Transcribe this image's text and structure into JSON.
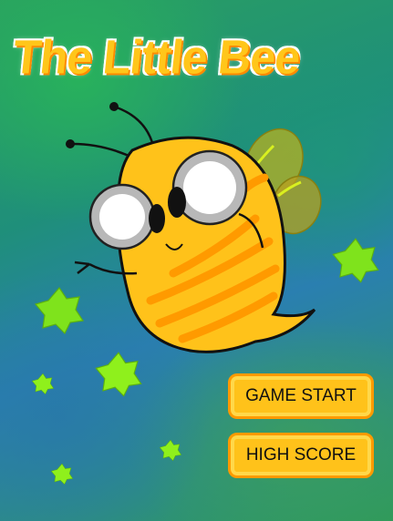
{
  "title": "The Little Bee",
  "menu": {
    "start_label": "GAME START",
    "score_label": "HIGH SCORE"
  },
  "colors": {
    "accent_yellow": "#ffc21a",
    "accent_orange": "#ff9a00",
    "star_green": "#7fe31c"
  },
  "icons": [
    "bee-character",
    "star-icon"
  ]
}
